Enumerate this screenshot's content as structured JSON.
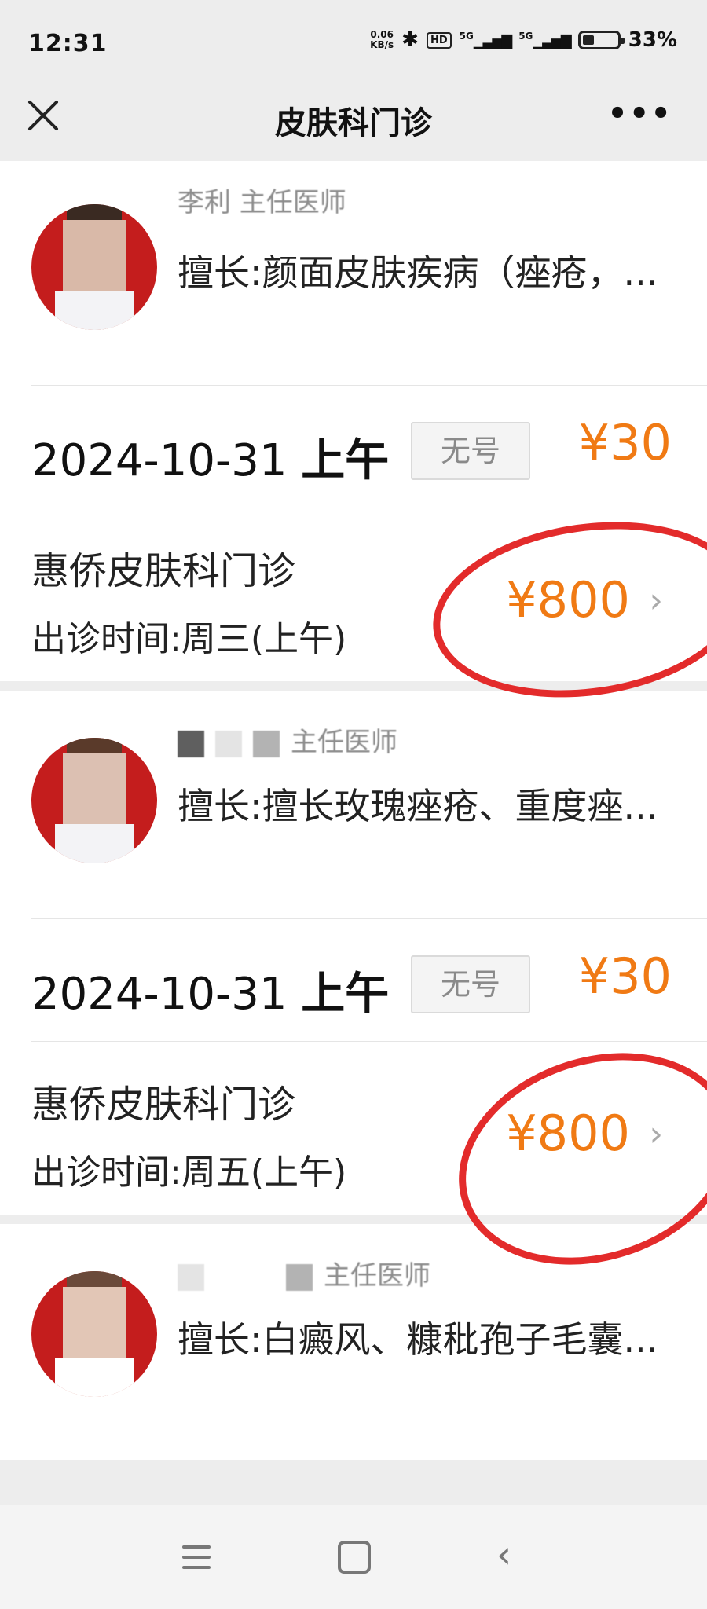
{
  "status": {
    "time": "12:31",
    "speed_top": "0.06",
    "speed_bottom": "KB/s",
    "hd": "HD",
    "net1": "5G",
    "net2": "5G",
    "battery": "33%",
    "battery_level": 0.33
  },
  "nav": {
    "title": "皮肤科门诊"
  },
  "doctors": [
    {
      "name": "李利  主任医师",
      "specialty": "擅长:颜面皮肤疾病（痤疮，...",
      "date": "2024-10-31",
      "period": "上午",
      "availability": "无号",
      "price": "¥30",
      "clinic": "惠侨皮肤科门诊",
      "clinic_time": "出诊时间:周三(上午)",
      "clinic_price": "¥800"
    },
    {
      "name": "主任医师",
      "specialty": "擅长:擅长玫瑰痤疮、重度痤...",
      "date": "2024-10-31",
      "period": "上午",
      "availability": "无号",
      "price": "¥30",
      "clinic": "惠侨皮肤科门诊",
      "clinic_time": "出诊时间:周五(上午)",
      "clinic_price": "¥800"
    },
    {
      "name": "主任医师",
      "specialty": "擅长:白癜风、糠秕孢子毛囊..."
    }
  ],
  "colors": {
    "accent": "#f07a14",
    "annotation": "#e32b2b"
  }
}
